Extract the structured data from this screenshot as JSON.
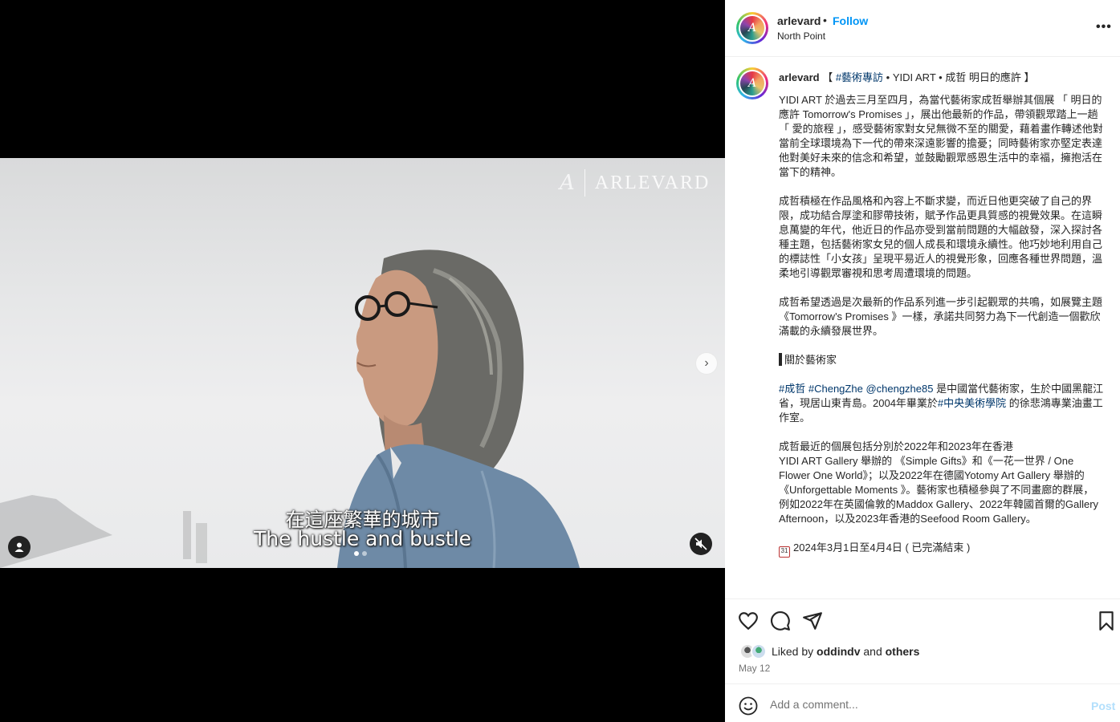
{
  "media": {
    "watermark": "ARLEVARD",
    "watermark_monogram": "A",
    "subtitle_zh": "在這座繁華的城市",
    "subtitle_en": "The hustle and bustle",
    "next_icon": "›",
    "carousel_dots": 2,
    "carousel_active": 0
  },
  "header": {
    "username": "arlevard",
    "separator": "•",
    "follow_label": "Follow",
    "location": "North Point",
    "more_icon": "•••"
  },
  "caption": {
    "username": "arlevard",
    "title_open": " 【 ",
    "title_tag": "#藝術專訪",
    "title_rest": " • YIDI ART • 成哲 明日的應許 】",
    "p1": "YIDI ART 於過去三月至四月，為當代藝術家成哲舉辦其個展 「 明日的應許 Tomorrow's Promises 」，展出他最新的作品，帶領觀眾踏上一趟「 愛的旅程 」，感受藝術家對女兒無微不至的關愛，藉着畫作轉述他對當前全球環境為下一代的帶來深遠影響的擔憂；同時藝術家亦堅定表達他對美好未來的信念和希望，並鼓勵觀眾感恩生活中的幸福，擁抱活在當下的精神。",
    "p2": "成哲積極在作品風格和內容上不斷求變，而近日他更突破了自己的界限，成功結合厚塗和膠帶技術，賦予作品更具質感的視覺效果。在這瞬息萬變的年代，他近日的作品亦受到當前問題的大幅啟發，深入探討各種主題，包括藝術家女兒的個人成長和環境永續性。他巧妙地利用自己的標誌性「小女孩」呈現平易近人的視覺形象，回應各種世界問題，溫柔地引導觀眾審視和思考周遭環境的問題。",
    "p3": "成哲希望透過是次最新的作品系列進一步引起觀眾的共鳴，如展覽主題《Tomorrow's Promises 》一樣，承諾共同努力為下一代創造一個歡欣滿載的永續發展世界。",
    "section_heading": "關於藝術家",
    "p4_tag1": "#成哲",
    "p4_tag2": "#ChengZhe",
    "p4_mention": "@chengzhe85",
    "p4_text1": " 是中國當代藝術家，生於中國黑龍江省，現居山東青島。2004年畢業於",
    "p4_tag3": "#中央美術學院",
    "p4_text2": " 的徐悲鴻專業油畫工作室。",
    "p5": "成哲最近的個展包括分別於2022年和2023年在香港\nYIDI ART Gallery 舉辦的 《Simple Gifts》和《一花一世界 / One Flower One World》；以及2022年在德國Yotomy Art Gallery 舉辦的《Unforgettable Moments 》。藝術家也積極參與了不同畫廊的群展，例如2022年在英國倫敦的Maddox Gallery、2022年韓國首爾的Gallery Afternoon，以及2023年香港的Seefood Room Gallery。",
    "calendar_icon_text": "31",
    "date_line": "2024年3月1日至4月4日 ( 已完滿結束 )"
  },
  "actions": {
    "liked_by_prefix": "Liked by ",
    "liked_by_user": "oddindv",
    "liked_by_mid": " and ",
    "liked_by_others": "others",
    "date": "May 12"
  },
  "comment": {
    "placeholder": "Add a comment...",
    "post_label": "Post"
  }
}
